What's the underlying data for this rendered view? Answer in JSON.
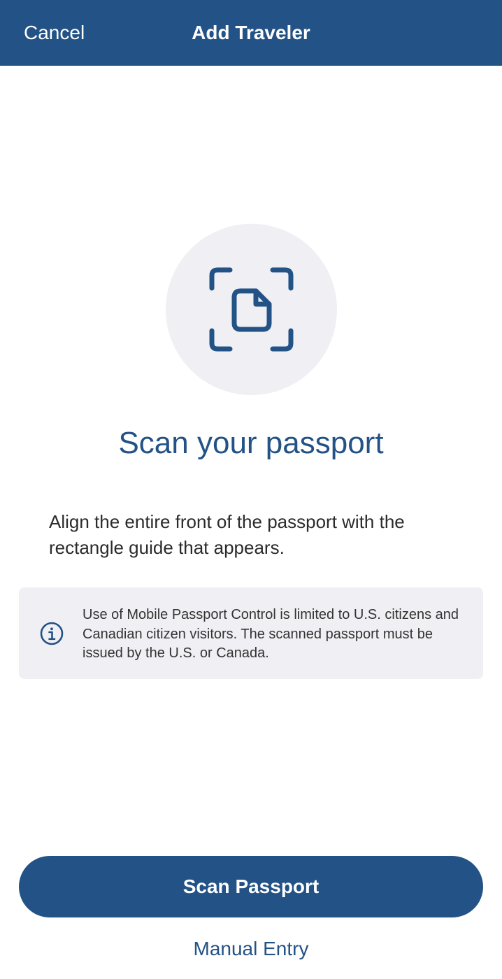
{
  "colors": {
    "brand": "#235286",
    "icon_background": "#f0f0f4",
    "info_background": "#f0f0f4",
    "body_text": "#2b2b2b"
  },
  "nav": {
    "cancel_label": "Cancel",
    "title": "Add Traveler"
  },
  "hero": {
    "icon": "document-scan-icon",
    "headline": "Scan your passport"
  },
  "instructions": "Align the entire front of the passport with the rectangle guide that appears.",
  "info": {
    "icon": "info-icon",
    "text": "Use of Mobile Passport Control is limited to U.S. citizens and Canadian citizen visitors. The scanned passport must be issued by the U.S. or Canada."
  },
  "actions": {
    "primary_label": "Scan Passport",
    "secondary_label": "Manual Entry"
  }
}
